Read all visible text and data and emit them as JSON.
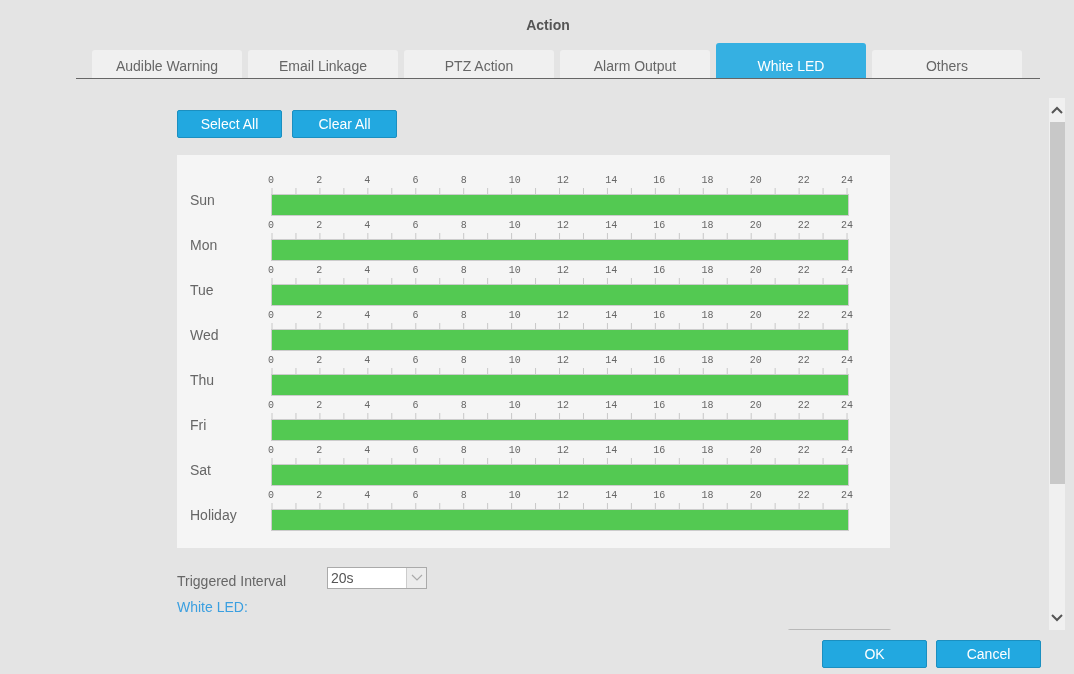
{
  "dialog": {
    "title": "Action"
  },
  "tabs": [
    {
      "label": "Audible Warning",
      "selected": false
    },
    {
      "label": "Email Linkage",
      "selected": false
    },
    {
      "label": "PTZ Action",
      "selected": false
    },
    {
      "label": "Alarm Output",
      "selected": false
    },
    {
      "label": "White LED",
      "selected": true
    },
    {
      "label": "Others",
      "selected": false
    }
  ],
  "schedule_buttons": [
    "Select All",
    "Clear All"
  ],
  "schedule": [
    {
      "day": "Sun",
      "level": 1,
      "ticks": [
        "0",
        "2",
        "4",
        "6",
        "8",
        "10",
        "12",
        "14",
        "16",
        "18",
        "20",
        "22",
        "24"
      ]
    },
    {
      "day": "Mon",
      "level": 1,
      "ticks": [
        "0",
        "2",
        "4",
        "6",
        "8",
        "10",
        "12",
        "14",
        "16",
        "18",
        "20",
        "22",
        "24"
      ]
    },
    {
      "day": "Tue",
      "level": 1,
      "ticks": [
        "0",
        "2",
        "4",
        "6",
        "8",
        "10",
        "12",
        "14",
        "16",
        "18",
        "20",
        "22",
        "24"
      ]
    },
    {
      "day": "Wed",
      "level": 1,
      "ticks": [
        "0",
        "2",
        "4",
        "6",
        "8",
        "10",
        "12",
        "14",
        "16",
        "18",
        "20",
        "22",
        "24"
      ]
    },
    {
      "day": "Thu",
      "level": 1,
      "ticks": [
        "0",
        "2",
        "4",
        "6",
        "8",
        "10",
        "12",
        "14",
        "16",
        "18",
        "20",
        "22",
        "24"
      ]
    },
    {
      "day": "Fri",
      "level": 1,
      "ticks": [
        "0",
        "2",
        "4",
        "6",
        "8",
        "10",
        "12",
        "14",
        "16",
        "18",
        "20",
        "22",
        "24"
      ]
    },
    {
      "day": "Sat",
      "level": 1,
      "ticks": [
        "0",
        "2",
        "4",
        "6",
        "8",
        "10",
        "12",
        "14",
        "16",
        "18",
        "20",
        "22",
        "24"
      ]
    },
    {
      "day": "Holiday",
      "level": 1,
      "ticks": [
        "0",
        "2",
        "4",
        "6",
        "8",
        "10",
        "12",
        "14",
        "16",
        "18",
        "20",
        "22",
        "24"
      ]
    }
  ],
  "triggered_interval": {
    "label": "Triggered Interval",
    "value": "20s"
  },
  "section_heading": "White LED:",
  "footer_buttons": [
    "OK",
    "Cancel"
  ]
}
